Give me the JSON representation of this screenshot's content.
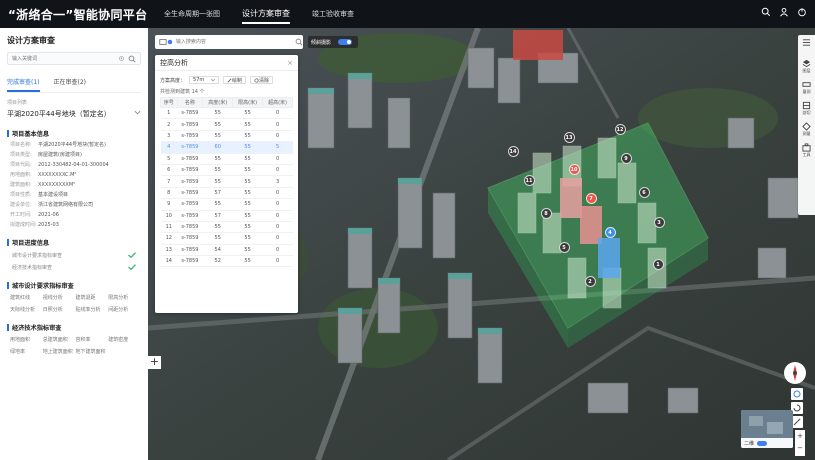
{
  "app": {
    "brand": "“浙络合一”智能协同平台",
    "nav": [
      "全生命周期一张图",
      "设计方案审查",
      "竣工验收审查"
    ],
    "active_nav": 1
  },
  "left": {
    "title": "设计方案审查",
    "search_placeholder": "输入关键词",
    "tabs": [
      "完成审查(1)",
      "正在审查(2)"
    ],
    "project_label": "项目列表",
    "project_name": "平湖2020平44号地块（暂定名）",
    "sec_basic": "项目基本信息",
    "basic": [
      {
        "k": "项目名称:",
        "v": "平湖2020平44号地块(暂定名)"
      },
      {
        "k": "项目类型:",
        "v": "房屋建筑(房建项目)"
      },
      {
        "k": "项目代码:",
        "v": "2012-330482-04-01-300004"
      },
      {
        "k": "用地面积:",
        "v": "XXXXXXXXC.M²"
      },
      {
        "k": "建筑面积:",
        "v": "XXXXXXXXXM²"
      },
      {
        "k": "项目性质:",
        "v": "基本建设项目"
      },
      {
        "k": "建设单位:",
        "v": "浙江省建筑网络有限公司"
      },
      {
        "k": "开工时间:",
        "v": "2021-06"
      },
      {
        "k": "拟建成时间:",
        "v": "2025-03"
      }
    ],
    "sec_progress": "项目进度信息",
    "progress": [
      "城市设计要求指标审查",
      "经济技术指标审查"
    ],
    "sec_city": "城市设计要求指标审查",
    "city_items": [
      "建筑红线",
      "视线分析",
      "建筑退距",
      "限高分析",
      "天际线分析",
      "日照分析",
      "贴线率分析",
      "间距分析"
    ],
    "sec_econ": "经济技术指标审查",
    "econ_items": [
      "用地面积",
      "总建筑面积",
      "容积率",
      "建筑密度",
      "绿地率",
      "地上建筑面积",
      "地下建筑面积"
    ]
  },
  "map": {
    "search_placeholder": "输入搜索内容",
    "toggle_label": "倾斜摄影",
    "mini_label": "二维",
    "bubbles": [
      {
        "n": "1"
      },
      {
        "n": "2"
      },
      {
        "n": "3"
      },
      {
        "n": "4"
      },
      {
        "n": "5"
      },
      {
        "n": "6"
      },
      {
        "n": "7"
      },
      {
        "n": "8"
      },
      {
        "n": "9"
      },
      {
        "n": "10"
      },
      {
        "n": "11"
      },
      {
        "n": "12"
      },
      {
        "n": "13"
      },
      {
        "n": "14"
      }
    ]
  },
  "panel": {
    "title": "控高分析",
    "height_label": "方案高度：",
    "height_value": "57m",
    "btn_draw": "绘制",
    "btn_clear": "清除",
    "count_text": "共检测到建筑 14 个",
    "headers": [
      "序号",
      "名称",
      "高度(米)",
      "限高(米)",
      "超高(米)"
    ],
    "rows": [
      [
        "1",
        "s-7859",
        "55",
        "55",
        "0"
      ],
      [
        "2",
        "s-7859",
        "55",
        "55",
        "0"
      ],
      [
        "3",
        "s-7859",
        "55",
        "55",
        "0"
      ],
      [
        "4",
        "s-7859",
        "60",
        "55",
        "5"
      ],
      [
        "5",
        "s-7859",
        "55",
        "55",
        "0"
      ],
      [
        "6",
        "s-7859",
        "55",
        "55",
        "0"
      ],
      [
        "7",
        "s-7859",
        "55",
        "55",
        "3"
      ],
      [
        "8",
        "s-7859",
        "57",
        "55",
        "0"
      ],
      [
        "9",
        "s-7859",
        "55",
        "55",
        "0"
      ],
      [
        "10",
        "s-7859",
        "57",
        "55",
        "0"
      ],
      [
        "11",
        "s-7859",
        "55",
        "55",
        "0"
      ],
      [
        "12",
        "s-7859",
        "55",
        "55",
        "0"
      ],
      [
        "13",
        "s-7859",
        "54",
        "55",
        "0"
      ],
      [
        "14",
        "s-7859",
        "52",
        "55",
        "0"
      ]
    ],
    "highlight_row": 3
  },
  "rtools": [
    "图层",
    "量测",
    "剖切",
    "测量",
    "工具"
  ]
}
